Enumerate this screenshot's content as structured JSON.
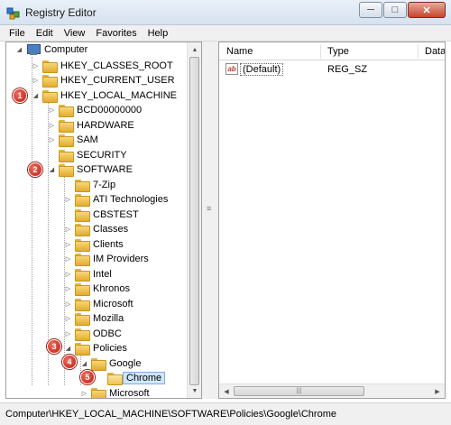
{
  "window": {
    "title": "Registry Editor",
    "controls": {
      "minimize": "─",
      "maximize": "□",
      "close": "✕"
    }
  },
  "menu": [
    "File",
    "Edit",
    "View",
    "Favorites",
    "Help"
  ],
  "tree": [
    {
      "label": "Computer",
      "icon": "computer-icon",
      "expander": "◢"
    },
    {
      "label": "HKEY_CLASSES_ROOT",
      "icon": "folder-icon",
      "expander": "▷"
    },
    {
      "label": "HKEY_CURRENT_USER",
      "icon": "folder-icon",
      "expander": "▷"
    },
    {
      "label": "HKEY_LOCAL_MACHINE",
      "icon": "folder-icon",
      "expander": "◢"
    },
    {
      "label": "BCD00000000",
      "icon": "folder-icon",
      "expander": "▷"
    },
    {
      "label": "HARDWARE",
      "icon": "folder-icon",
      "expander": "▷"
    },
    {
      "label": "SAM",
      "icon": "folder-icon",
      "expander": "▷"
    },
    {
      "label": "SECURITY",
      "icon": "folder-icon",
      "expander": ""
    },
    {
      "label": "SOFTWARE",
      "icon": "folder-icon",
      "expander": "◢"
    },
    {
      "label": "7-Zip",
      "icon": "folder-icon",
      "expander": ""
    },
    {
      "label": "ATI Technologies",
      "icon": "folder-icon",
      "expander": "▷"
    },
    {
      "label": "CBSTEST",
      "icon": "folder-icon",
      "expander": ""
    },
    {
      "label": "Classes",
      "icon": "folder-icon",
      "expander": "▷"
    },
    {
      "label": "Clients",
      "icon": "folder-icon",
      "expander": "▷"
    },
    {
      "label": "IM Providers",
      "icon": "folder-icon",
      "expander": "▷"
    },
    {
      "label": "Intel",
      "icon": "folder-icon",
      "expander": "▷"
    },
    {
      "label": "Khronos",
      "icon": "folder-icon",
      "expander": "▷"
    },
    {
      "label": "Microsoft",
      "icon": "folder-icon",
      "expander": "▷"
    },
    {
      "label": "Mozilla",
      "icon": "folder-icon",
      "expander": "▷"
    },
    {
      "label": "ODBC",
      "icon": "folder-icon",
      "expander": "▷"
    },
    {
      "label": "Policies",
      "icon": "folder-icon",
      "expander": "◢"
    },
    {
      "label": "Google",
      "icon": "folder-icon",
      "expander": "◢"
    },
    {
      "label": "Chrome",
      "icon": "open-folder-icon",
      "expander": "",
      "selected": true
    },
    {
      "label": "Microsoft",
      "icon": "folder-icon",
      "expander": "▷"
    }
  ],
  "list": {
    "columns": [
      "Name",
      "Type",
      "Data"
    ],
    "rows": [
      {
        "name": "(Default)",
        "type": "REG_SZ",
        "icon": "string-value-icon",
        "icon_text": "ab"
      }
    ]
  },
  "status_bar": {
    "path": "Computer\\HKEY_LOCAL_MACHINE\\SOFTWARE\\Policies\\Google\\Chrome"
  },
  "markers": [
    "1",
    "2",
    "3",
    "4",
    "5"
  ],
  "colors": {
    "marker_red": "#d0281c",
    "selection": "#cfe6fb",
    "folder": "#f0c24a"
  }
}
